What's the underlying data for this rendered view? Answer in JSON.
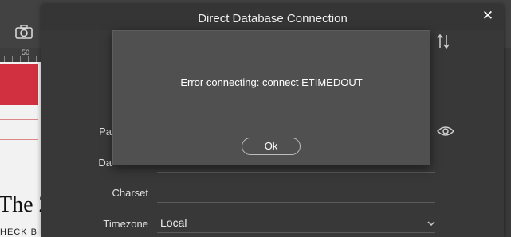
{
  "background_app": {
    "ruler_mark": "50",
    "doc_heading_fragment": "The 2",
    "doc_subtext_fragment": "HECK B"
  },
  "dialog": {
    "title": "Direct Database Connection",
    "close_icon": "close-icon",
    "sort_icon": "sort-arrows-icon",
    "fields": {
      "password_label": "Pa",
      "database_label": "Da",
      "charset_label": "Charset",
      "charset_value": "",
      "timezone_label": "Timezone",
      "timezone_value": "Local"
    },
    "password_toggle_icon": "eye-icon"
  },
  "error_modal": {
    "message": "Error connecting: connect ETIMEDOUT",
    "ok_label": "Ok"
  },
  "colors": {
    "dialog_bg": "#2e2e2e",
    "modal_bg": "#505050",
    "doc_accent": "#d03040"
  }
}
